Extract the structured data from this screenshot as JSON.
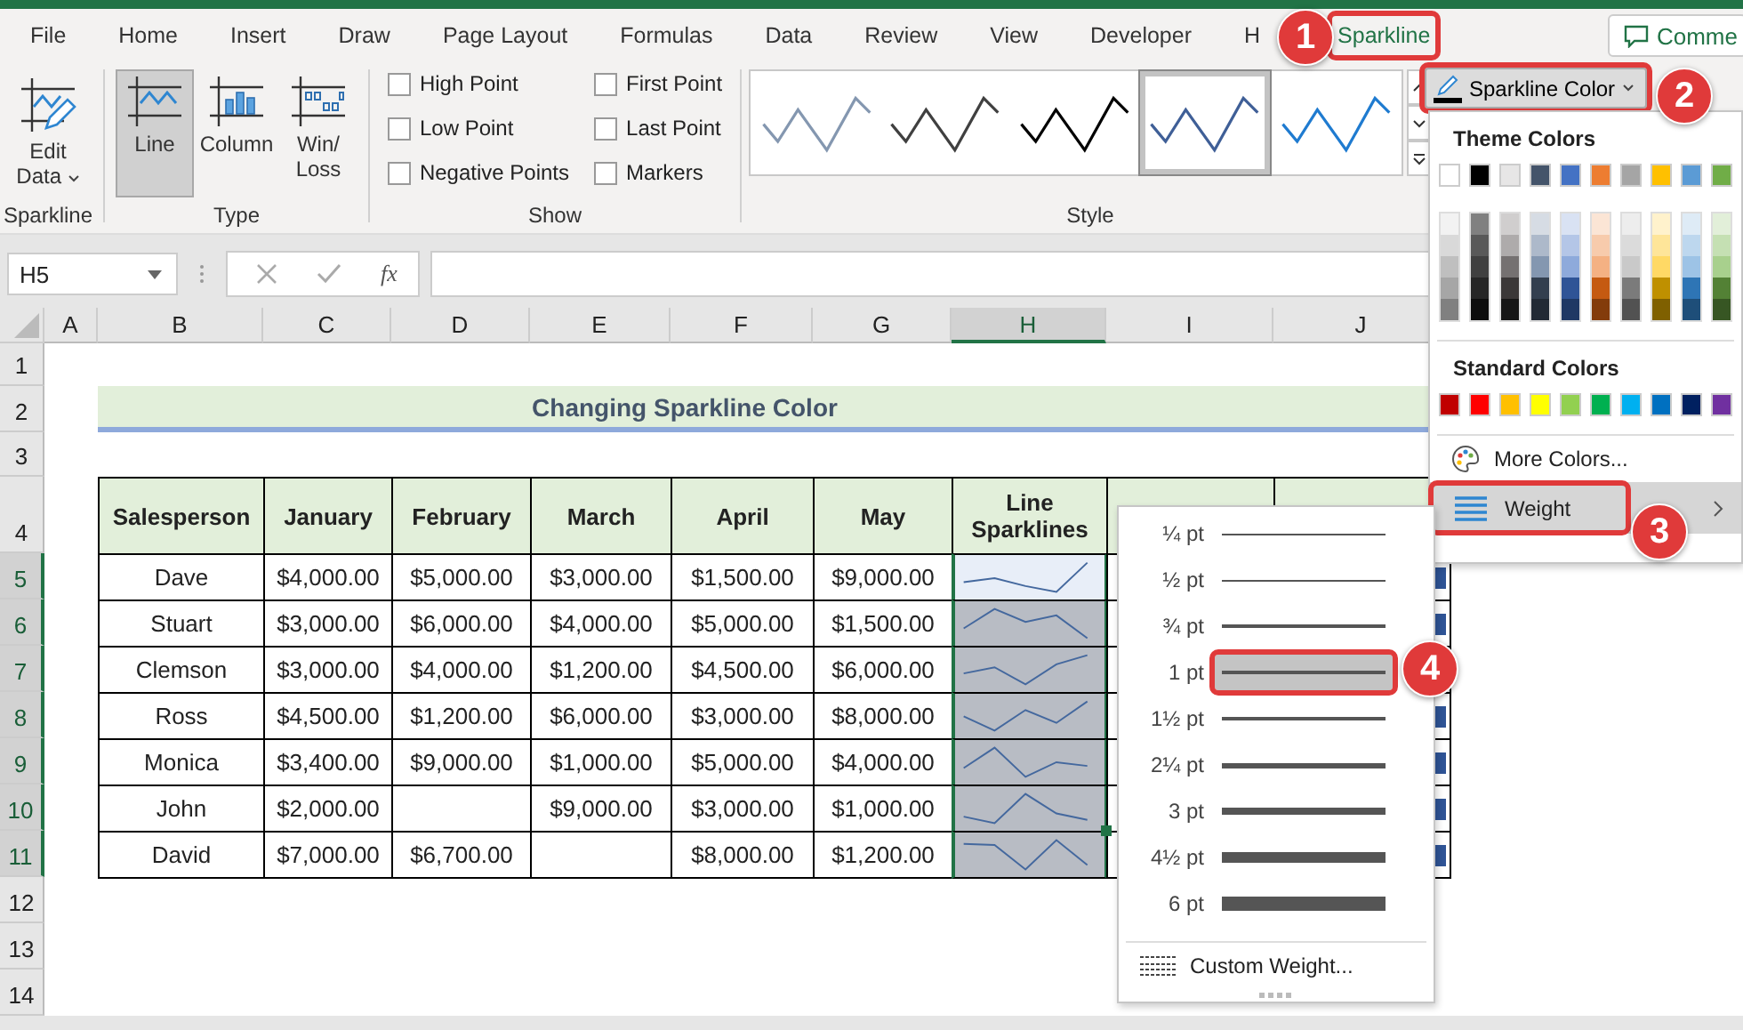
{
  "tabs": [
    {
      "label": "File",
      "selected": false,
      "highlighted": false
    },
    {
      "label": "Home",
      "selected": false,
      "highlighted": false
    },
    {
      "label": "Insert",
      "selected": false,
      "highlighted": false
    },
    {
      "label": "Draw",
      "selected": false,
      "highlighted": false
    },
    {
      "label": "Page Layout",
      "selected": false,
      "highlighted": false
    },
    {
      "label": "Formulas",
      "selected": false,
      "highlighted": false
    },
    {
      "label": "Data",
      "selected": false,
      "highlighted": false
    },
    {
      "label": "Review",
      "selected": false,
      "highlighted": false
    },
    {
      "label": "View",
      "selected": false,
      "highlighted": false
    },
    {
      "label": "Developer",
      "selected": false,
      "highlighted": false
    },
    {
      "label": "H",
      "selected": false,
      "highlighted": false
    },
    {
      "label": "Sparkline",
      "selected": true,
      "highlighted": true
    }
  ],
  "comments_button": "Comme",
  "sparkline_group": {
    "label": "Sparkline",
    "edit_data": "Edit\nData"
  },
  "type_group": {
    "label": "Type",
    "buttons": [
      {
        "label": "Line",
        "kind": "line",
        "selected": true
      },
      {
        "label": "Column",
        "kind": "column",
        "selected": false
      },
      {
        "label": "Win/\nLoss",
        "kind": "winloss",
        "selected": false
      }
    ]
  },
  "show_group": {
    "label": "Show",
    "options": [
      {
        "label": "High Point",
        "checked": false
      },
      {
        "label": "Low Point",
        "checked": false
      },
      {
        "label": "Negative Points",
        "checked": false
      },
      {
        "label": "First Point",
        "checked": false
      },
      {
        "label": "Last Point",
        "checked": false
      },
      {
        "label": "Markers",
        "checked": false
      }
    ]
  },
  "style_group": {
    "label": "Style",
    "styles": [
      {
        "color": "#8497b0",
        "selected": false
      },
      {
        "color": "#404040",
        "selected": false
      },
      {
        "color": "#000000",
        "selected": false
      },
      {
        "color": "#3f5f97",
        "selected": true
      },
      {
        "color": "#1f7bd0",
        "selected": false
      }
    ]
  },
  "sparkline_color": {
    "label": "Sparkline Color",
    "highlighted": true
  },
  "formula_bar": {
    "name_box": "H5",
    "function_label": "fx"
  },
  "columns": [
    {
      "label": "A",
      "selected": false
    },
    {
      "label": "B",
      "selected": false
    },
    {
      "label": "C",
      "selected": false
    },
    {
      "label": "D",
      "selected": false
    },
    {
      "label": "E",
      "selected": false
    },
    {
      "label": "F",
      "selected": false
    },
    {
      "label": "G",
      "selected": false
    },
    {
      "label": "H",
      "selected": true
    },
    {
      "label": "I",
      "selected": false
    },
    {
      "label": "J",
      "selected": false
    }
  ],
  "row_numbers": [
    {
      "label": "1",
      "selected": false
    },
    {
      "label": "2",
      "selected": false
    },
    {
      "label": "3",
      "selected": false
    },
    {
      "label": "4",
      "selected": false
    },
    {
      "label": "5",
      "selected": true
    },
    {
      "label": "6",
      "selected": true
    },
    {
      "label": "7",
      "selected": true
    },
    {
      "label": "8",
      "selected": true
    },
    {
      "label": "9",
      "selected": true
    },
    {
      "label": "10",
      "selected": true
    },
    {
      "label": "11",
      "selected": true
    },
    {
      "label": "12",
      "selected": false
    },
    {
      "label": "13",
      "selected": false
    },
    {
      "label": "14",
      "selected": false
    }
  ],
  "title": "Changing Sparkline Color",
  "table": {
    "columns": [
      "Salesperson",
      "January",
      "February",
      "March",
      "April",
      "May",
      "Line\nSparklines"
    ],
    "rows": [
      {
        "cells": [
          "Dave",
          "$4,000.00",
          "$5,000.00",
          "$3,000.00",
          "$1,500.00",
          "$9,000.00"
        ],
        "active": true
      },
      {
        "cells": [
          "Stuart",
          "$3,000.00",
          "$6,000.00",
          "$4,000.00",
          "$5,000.00",
          "$1,500.00"
        ],
        "active": false
      },
      {
        "cells": [
          "Clemson",
          "$3,000.00",
          "$4,000.00",
          "$1,200.00",
          "$4,500.00",
          "$6,000.00"
        ],
        "active": false
      },
      {
        "cells": [
          "Ross",
          "$4,500.00",
          "$1,200.00",
          "$6,000.00",
          "$3,000.00",
          "$8,000.00"
        ],
        "active": false
      },
      {
        "cells": [
          "Monica",
          "$3,400.00",
          "$9,000.00",
          "$1,000.00",
          "$5,000.00",
          "$4,000.00"
        ],
        "active": false
      },
      {
        "cells": [
          "John",
          "$2,000.00",
          null,
          "$9,000.00",
          "$3,000.00",
          "$1,000.00"
        ],
        "active": false
      },
      {
        "cells": [
          "David",
          "$7,000.00",
          "$6,700.00",
          null,
          "$8,000.00",
          "$1,200.00"
        ],
        "active": false
      }
    ]
  },
  "color_menu": {
    "theme_title": "Theme Colors",
    "theme_colors": [
      {
        "color": "#ffffff"
      },
      {
        "color": "#000000"
      },
      {
        "color": "#e7e6e6"
      },
      {
        "color": "#44546a"
      },
      {
        "color": "#4472c4"
      },
      {
        "color": "#ed7d31"
      },
      {
        "color": "#a5a5a5"
      },
      {
        "color": "#ffc000"
      },
      {
        "color": "#5b9bd5"
      },
      {
        "color": "#70ad47"
      }
    ],
    "shade_columns": [
      {
        "shades": [
          {
            "color": "#f2f2f2"
          },
          {
            "color": "#d9d9d9"
          },
          {
            "color": "#bfbfbf"
          },
          {
            "color": "#a6a6a6"
          },
          {
            "color": "#808080"
          }
        ]
      },
      {
        "shades": [
          {
            "color": "#808080"
          },
          {
            "color": "#595959"
          },
          {
            "color": "#404040"
          },
          {
            "color": "#262626"
          },
          {
            "color": "#0d0d0d"
          }
        ]
      },
      {
        "shades": [
          {
            "color": "#d0cece"
          },
          {
            "color": "#aeabab"
          },
          {
            "color": "#757171"
          },
          {
            "color": "#3b3838"
          },
          {
            "color": "#161616"
          }
        ]
      },
      {
        "shades": [
          {
            "color": "#d6dce4"
          },
          {
            "color": "#adb9ca"
          },
          {
            "color": "#8497b0"
          },
          {
            "color": "#333f4f"
          },
          {
            "color": "#222a35"
          }
        ]
      },
      {
        "shades": [
          {
            "color": "#d9e2f3"
          },
          {
            "color": "#b4c6e7"
          },
          {
            "color": "#8eaadb"
          },
          {
            "color": "#2f5496"
          },
          {
            "color": "#1f3864"
          }
        ]
      },
      {
        "shades": [
          {
            "color": "#fbe5d5"
          },
          {
            "color": "#f7cbac"
          },
          {
            "color": "#f4b183"
          },
          {
            "color": "#c55a11"
          },
          {
            "color": "#833c0b"
          }
        ]
      },
      {
        "shades": [
          {
            "color": "#ededed"
          },
          {
            "color": "#dbdbdb"
          },
          {
            "color": "#c9c9c9"
          },
          {
            "color": "#7b7b7b"
          },
          {
            "color": "#525252"
          }
        ]
      },
      {
        "shades": [
          {
            "color": "#fff2cc"
          },
          {
            "color": "#fee599"
          },
          {
            "color": "#ffd965"
          },
          {
            "color": "#bf9000"
          },
          {
            "color": "#7f6000"
          }
        ]
      },
      {
        "shades": [
          {
            "color": "#deebf6"
          },
          {
            "color": "#bdd7ee"
          },
          {
            "color": "#9dc3e6"
          },
          {
            "color": "#2e75b5"
          },
          {
            "color": "#1e4e79"
          }
        ]
      },
      {
        "shades": [
          {
            "color": "#e2efd9"
          },
          {
            "color": "#c5e0b3"
          },
          {
            "color": "#a8d08d"
          },
          {
            "color": "#538135"
          },
          {
            "color": "#375623"
          }
        ]
      }
    ],
    "standard_title": "Standard Colors",
    "standard_colors": [
      {
        "color": "#c00000"
      },
      {
        "color": "#ff0000"
      },
      {
        "color": "#ffc000"
      },
      {
        "color": "#ffff00"
      },
      {
        "color": "#92d050"
      },
      {
        "color": "#00b050"
      },
      {
        "color": "#00b0f0"
      },
      {
        "color": "#0070c0"
      },
      {
        "color": "#002060"
      },
      {
        "color": "#7030a0"
      }
    ],
    "more_colors": "More Colors...",
    "weight": {
      "label": "Weight",
      "highlighted": true
    }
  },
  "weight_menu": {
    "items": [
      {
        "label": "¼ pt",
        "selected": false,
        "highlighted": false
      },
      {
        "label": "½ pt",
        "selected": false,
        "highlighted": false
      },
      {
        "label": "¾ pt",
        "selected": false,
        "highlighted": false
      },
      {
        "label": "1 pt",
        "selected": true,
        "highlighted": true
      },
      {
        "label": "1½ pt",
        "selected": false,
        "highlighted": false
      },
      {
        "label": "2¼ pt",
        "selected": false,
        "highlighted": false
      },
      {
        "label": "3 pt",
        "selected": false,
        "highlighted": false
      },
      {
        "label": "4½ pt",
        "selected": false,
        "highlighted": false
      },
      {
        "label": "6 pt",
        "selected": false,
        "highlighted": false
      }
    ],
    "custom": "Custom Weight..."
  },
  "callouts": [
    "1",
    "2",
    "3",
    "4"
  ]
}
